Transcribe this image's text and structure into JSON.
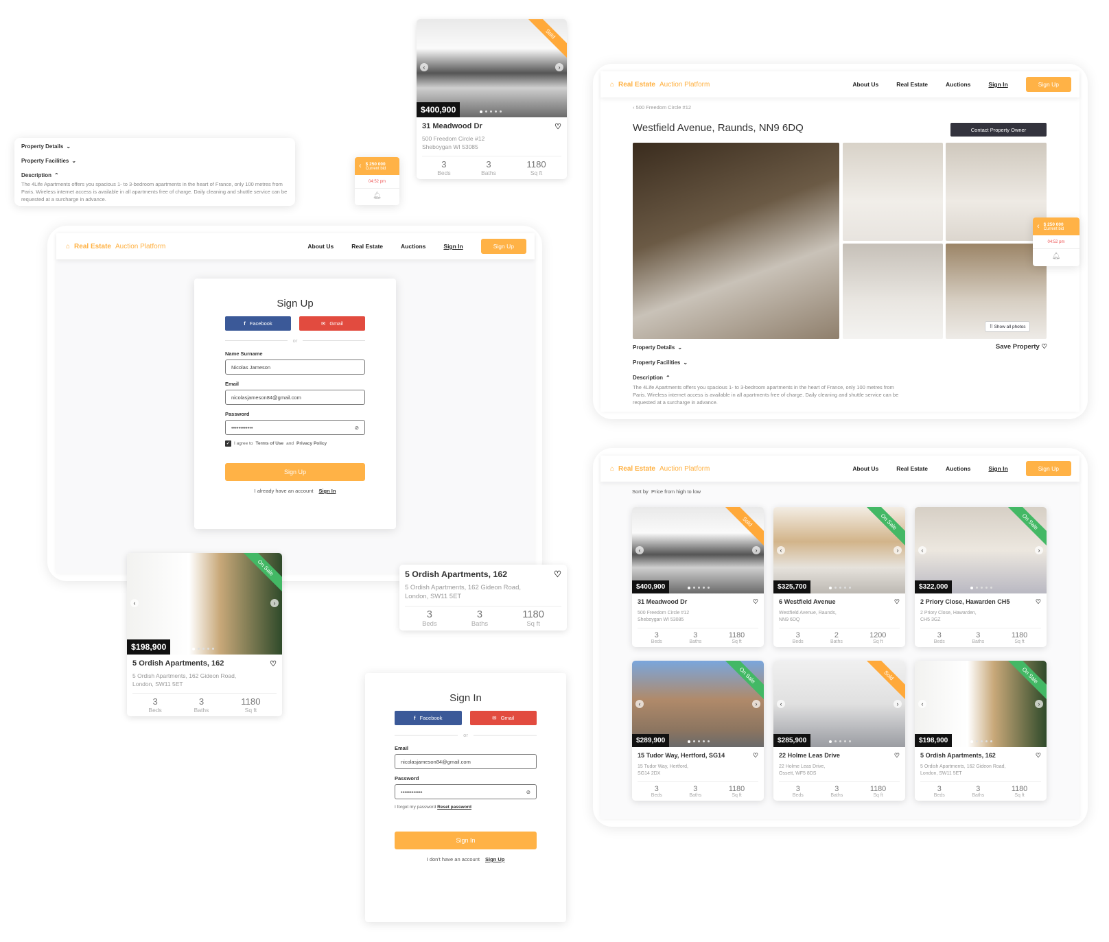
{
  "brand": {
    "bold": "Real Estate",
    "light": "Auction Platform",
    "accent": "#ffb246"
  },
  "nav": {
    "about": "About Us",
    "real_estate": "Real Estate",
    "auctions": "Auctions",
    "sign_in": "Sign In",
    "sign_up": "Sign Up"
  },
  "description": {
    "details": "Property Details",
    "facilities": "Property Facilities",
    "title": "Description",
    "text": "The 4Life Apartments offers you spacious 1- to 3-bedroom apartments in the heart of France, only 100 metres from Paris. Wireless internet access is available in all apartments free of charge. Daily cleaning and shuttle service can be requested at a surcharge in advance."
  },
  "bid": {
    "amount": "$ 250 000",
    "label": "Current bid",
    "time": "04:52 pm"
  },
  "detail": {
    "breadcrumb": "500 Freedom Circle #12",
    "title": "Westfield Avenue, Raunds, NN9 6DQ",
    "contact": "Contact Property Owner",
    "show_all": "Show all photos",
    "save": "Save Property"
  },
  "labels": {
    "beds": "Beds",
    "baths": "Baths",
    "sqft": "Sq ft"
  },
  "sort": {
    "label": "Sort by",
    "value": "Price from high to low"
  },
  "status_colors": {
    "Sold": "#ffa93a",
    "On Sale": "#43b865"
  },
  "top_card": {
    "price": "$400,900",
    "status": "Sold",
    "title": "31 Meadwood Dr",
    "addr1": "500 Freedom Circle #12",
    "addr2": "Sheboygan WI 53085",
    "beds": "3",
    "baths": "3",
    "sqft": "1180"
  },
  "ordish_card": {
    "price": "$198,900",
    "status": "On Sale",
    "title": "5 Ordish Apartments, 162",
    "addr1": "5 Ordish Apartments, 162 Gideon Road,",
    "addr2": "London, SW11 5ET",
    "beds": "3",
    "baths": "3",
    "sqft": "1180"
  },
  "listings": [
    {
      "price": "$400,900",
      "status": "Sold",
      "title": "31 Meadwood Dr",
      "addr1": "500 Freedom Circle #12",
      "addr2": "Sheboygan WI 53085",
      "beds": "3",
      "baths": "3",
      "sqft": "1180"
    },
    {
      "price": "$325,700",
      "status": "On Sale",
      "title": "6 Westfield Avenue",
      "addr1": "Westfield Avenue, Raunds,",
      "addr2": "NN9 6DQ",
      "beds": "3",
      "baths": "2",
      "sqft": "1200"
    },
    {
      "price": "$322,000",
      "status": "On Sale",
      "title": "2 Priory Close, Hawarden CH5",
      "addr1": "2 Priory Close, Hawarden,",
      "addr2": "CH5 3GZ",
      "beds": "3",
      "baths": "3",
      "sqft": "1180"
    },
    {
      "price": "$289,900",
      "status": "On Sale",
      "title": "15 Tudor Way, Hertford, SG14",
      "addr1": "15 Tudor Way, Hertford,",
      "addr2": "SG14 2DX",
      "beds": "3",
      "baths": "3",
      "sqft": "1180"
    },
    {
      "price": "$285,900",
      "status": "Sold",
      "title": "22 Holme Leas Drive",
      "addr1": "22 Holme Leas Drive,",
      "addr2": "Ossett, WF5 8DS",
      "beds": "3",
      "baths": "3",
      "sqft": "1180"
    },
    {
      "price": "$198,900",
      "status": "On Sale",
      "title": "5 Ordish Apartments, 162",
      "addr1": "5 Ordish Apartments, 162 Gideon Road,",
      "addr2": "London, SW11 5ET",
      "beds": "3",
      "baths": "3",
      "sqft": "1180"
    }
  ],
  "signup": {
    "title": "Sign Up",
    "facebook": "Facebook",
    "gmail": "Gmail",
    "or": "or",
    "name_label": "Name Surname",
    "name_value": "Nicolas Jameson",
    "email_label": "Email",
    "email_value": "nicolasjameson84@gmail.com",
    "password_label": "Password",
    "password_value": "••••••••••••",
    "agree_prefix": "I agree to",
    "terms": "Terms of Use",
    "and": "and",
    "privacy": "Privacy Policy",
    "submit": "Sign Up",
    "footer": "I already have an account",
    "footer_link": "Sign In"
  },
  "signin": {
    "title": "Sign In",
    "facebook": "Facebook",
    "gmail": "Gmail",
    "or": "or",
    "email_label": "Email",
    "email_value": "nicolasjameson84@gmail.com",
    "password_label": "Password",
    "password_value": "••••••••••••",
    "forgot": "I forgot my password",
    "reset": "Reset password",
    "submit": "Sign In",
    "footer": "I don't have an account",
    "footer_link": "Sign Up"
  }
}
